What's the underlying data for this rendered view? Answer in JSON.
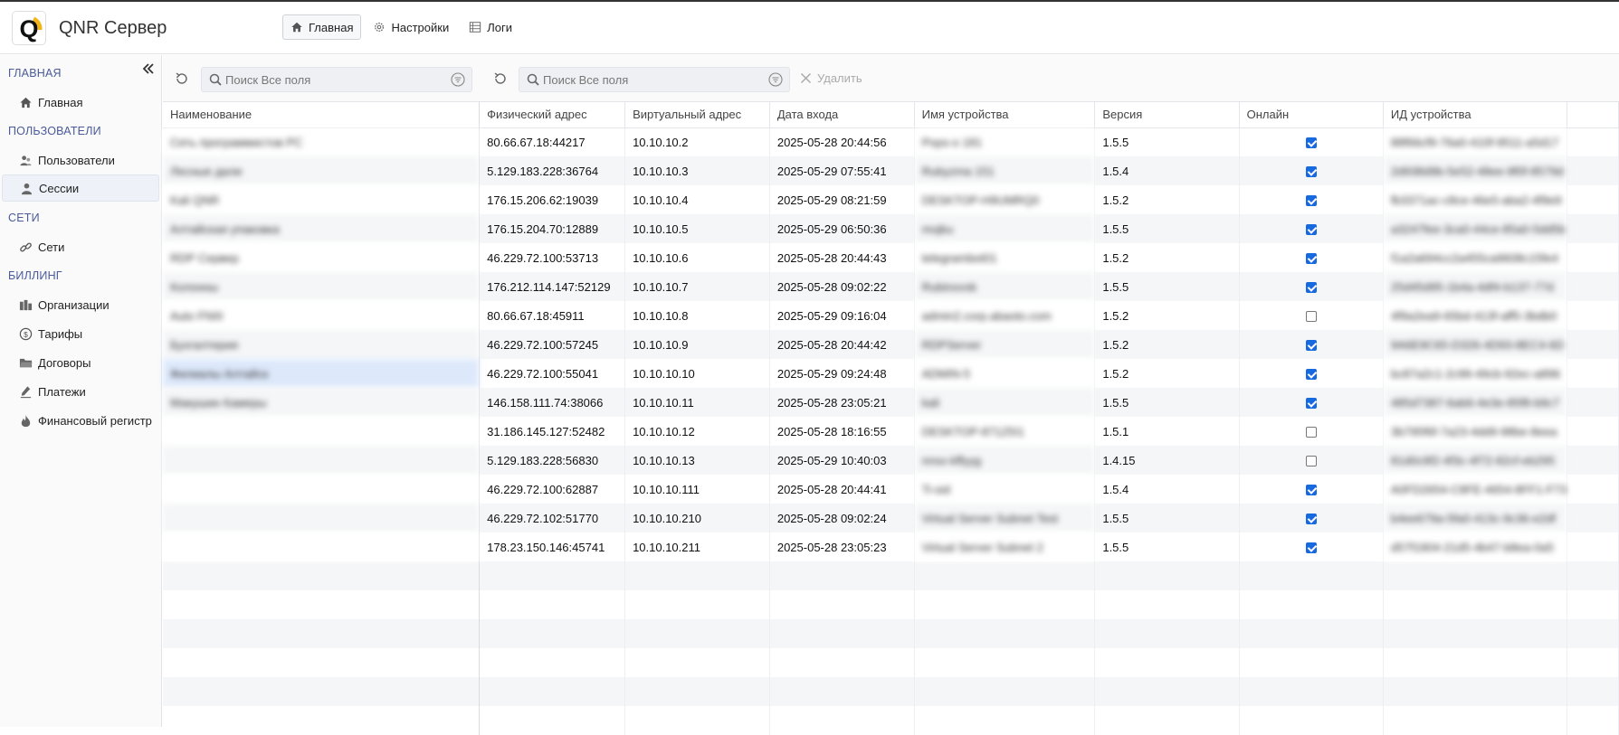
{
  "app": {
    "title": "QNR Сервер",
    "logo_letter": "Q"
  },
  "topnav": [
    {
      "label": "Главная",
      "icon": "home-icon",
      "active": true
    },
    {
      "label": "Настройки",
      "icon": "gear-icon",
      "active": false
    },
    {
      "label": "Логи",
      "icon": "list-icon",
      "active": false
    }
  ],
  "sidebar": {
    "sections": [
      {
        "title": "ГЛАВНАЯ",
        "items": [
          {
            "label": "Главная",
            "icon": "home-icon"
          }
        ]
      },
      {
        "title": "ПОЛЬЗОВАТЕЛИ",
        "items": [
          {
            "label": "Пользователи",
            "icon": "users-icon"
          },
          {
            "label": "Сессии",
            "icon": "user-icon",
            "active": true
          }
        ]
      },
      {
        "title": "СЕТИ",
        "items": [
          {
            "label": "Сети",
            "icon": "link-icon"
          }
        ]
      },
      {
        "title": "БИЛЛИНГ",
        "items": [
          {
            "label": "Организации",
            "icon": "building-icon"
          },
          {
            "label": "Тарифы",
            "icon": "dollar-icon"
          },
          {
            "label": "Договоры",
            "icon": "folder-icon"
          },
          {
            "label": "Платежи",
            "icon": "pen-icon"
          },
          {
            "label": "Финансовый регистр",
            "icon": "flame-icon"
          }
        ]
      }
    ]
  },
  "toolbar": {
    "search_left_placeholder": "Поиск Все поля",
    "search_right_placeholder": "Поиск Все поля",
    "delete_label": "Удалить"
  },
  "columns": [
    "Наименование",
    "Физический адрес",
    "Виртуальный адрес",
    "Дата входа",
    "Имя устройства",
    "Версия",
    "Онлайн",
    "ИД устройства"
  ],
  "rows": [
    {
      "name": "Сеть программистов РС",
      "phys": "80.66.67.18:44217",
      "virt": "10.10.10.2",
      "date": "2025-05-28 20:44:56",
      "device": "Pops-o 181",
      "version": "1.5.5",
      "online": true,
      "id": "88f66cf9-76a0-410f-9511-a5d17"
    },
    {
      "name": "Лесные дали",
      "phys": "5.129.183.228:36764",
      "virt": "10.10.10.3",
      "date": "2025-05-29 07:55:41",
      "device": "Rubyzma 151",
      "version": "1.5.4",
      "online": true,
      "id": "2d938d9b-5e52-48ee-9f0f-8579d"
    },
    {
      "name": "Kali QNR",
      "phys": "176.15.206.62:19039",
      "virt": "10.10.10.4",
      "date": "2025-05-29 08:21:59",
      "device": "DESKTOP-H9UMRQ0",
      "version": "1.5.2",
      "online": true,
      "id": "fb3371ac-c8ce-46e5-aba2-4f9e9"
    },
    {
      "name": "Алтайская упаковка",
      "phys": "176.15.204.70:12889",
      "virt": "10.10.10.5",
      "date": "2025-05-29 06:50:36",
      "device": "mojku",
      "version": "1.5.5",
      "online": true,
      "id": "a3247fee-3ca0-44ce-85a0-5dd5b"
    },
    {
      "name": "RDP Сервер",
      "phys": "46.229.72.100:53713",
      "virt": "10.10.10.6",
      "date": "2025-05-28 20:44:43",
      "device": "telegrambot01",
      "version": "1.5.2",
      "online": true,
      "id": "f1a2a694cc2a455ca9608c15fe4"
    },
    {
      "name": "Колонны",
      "phys": "176.212.114.147:52129",
      "virt": "10.10.10.7",
      "date": "2025-05-28 09:02:22",
      "device": "Rubinovsk",
      "version": "1.5.5",
      "online": true,
      "id": "25d45d95-1b4a-4df4-b137-77d"
    },
    {
      "name": "Auto FNIII",
      "phys": "80.66.67.18:45911",
      "virt": "10.10.10.8",
      "date": "2025-05-29 09:16:04",
      "device": "admin2.corp.abaoto.com",
      "version": "1.5.2",
      "online": false,
      "id": "4f9a2ea9-65bd-413f-aff5-3bdb0"
    },
    {
      "name": "Бухгалтерия",
      "phys": "46.229.72.100:57245",
      "virt": "10.10.10.9",
      "date": "2025-05-28 20:44:42",
      "device": "RDPServer",
      "version": "1.5.2",
      "online": true,
      "id": "9A6E9C65-D326-4D93-8EC4-6D"
    },
    {
      "name": "Филиалы Алтайск",
      "phys": "46.229.72.100:55041",
      "virt": "10.10.10.10",
      "date": "2025-05-29 09:24:48",
      "device": "ADMIN-5",
      "version": "1.5.2",
      "online": true,
      "id": "bc87a2c1-2c99-49cb-92ec-a896"
    },
    {
      "name": "Макушин Камеры",
      "phys": "146.158.111.74:38066",
      "virt": "10.10.10.11",
      "date": "2025-05-28 23:05:21",
      "device": "kali",
      "version": "1.5.5",
      "online": true,
      "id": "485d7387-6ab6-4e3e-85f8-b9c7"
    },
    {
      "name": "",
      "phys": "31.186.145.127:52482",
      "virt": "10.10.10.12",
      "date": "2025-05-28 18:16:55",
      "device": "DESKTOP-87125I1",
      "version": "1.5.1",
      "online": false,
      "id": "3b795f6f-7a23-4dd9-98be-8eea"
    },
    {
      "name": "",
      "phys": "5.129.183.228:56830",
      "virt": "10.10.10.13",
      "date": "2025-05-29 10:40:03",
      "device": "nnsx-kffyyg",
      "version": "1.4.15",
      "online": false,
      "id": "81d0c9f2-4f3c-4f72-82cf-eb295"
    },
    {
      "name": "",
      "phys": "46.229.72.100:62887",
      "virt": "10.10.10.111",
      "date": "2025-05-28 20:44:41",
      "device": "Ti-sid",
      "version": "1.5.4",
      "online": true,
      "id": "A0FD2654-C8FE-4654-8FF1-F73"
    },
    {
      "name": "",
      "phys": "46.229.72.102:51770",
      "virt": "10.10.10.210",
      "date": "2025-05-28 09:02:24",
      "device": "Virtual Server Subnet Test",
      "version": "1.5.5",
      "online": true,
      "id": "b4ee679a-5fa0-413c-9c36-e2df"
    },
    {
      "name": "",
      "phys": "178.23.150.146:45741",
      "virt": "10.10.10.211",
      "date": "2025-05-28 23:05:23",
      "device": "Virtual Server Subnet 2",
      "version": "1.5.5",
      "online": true,
      "id": "d57f1904-21d5-4b47-b8ea-0a5"
    }
  ],
  "colors": {
    "accent": "#1769e0",
    "section_title": "#4a5a9a",
    "selected_row": "#dde9fb"
  }
}
